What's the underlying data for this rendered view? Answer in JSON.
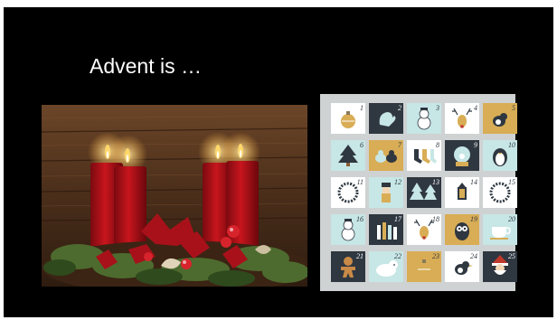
{
  "slide": {
    "title": "Advent is …"
  },
  "photo": {
    "subject": "advent-wreath-four-red-candles",
    "colors": {
      "wood": "#5a3a22",
      "candle": "#b3121a",
      "flame": "#ffcf5a",
      "greenery": "#4d6b2e"
    }
  },
  "calendar": {
    "background": "#cfd2d2",
    "tiles": [
      {
        "num": "1",
        "icon": "ornament-icon",
        "bg": "#ffffff"
      },
      {
        "num": "2",
        "icon": "mitten-icon",
        "bg": "#2f3740"
      },
      {
        "num": "3",
        "icon": "snowman-icon",
        "bg": "#c7e6e6"
      },
      {
        "num": "4",
        "icon": "reindeer-icon",
        "bg": "#ffffff"
      },
      {
        "num": "5",
        "icon": "bird-icon",
        "bg": "#d8ad55"
      },
      {
        "num": "6",
        "icon": "christmas-tree-icon",
        "bg": "#c7e6e6"
      },
      {
        "num": "7",
        "icon": "birds-icon",
        "bg": "#d8ad55"
      },
      {
        "num": "8",
        "icon": "stockings-icon",
        "bg": "#ffffff"
      },
      {
        "num": "9",
        "icon": "snow-globe-icon",
        "bg": "#2f3740"
      },
      {
        "num": "10",
        "icon": "penguin-icon",
        "bg": "#c7e6e6"
      },
      {
        "num": "11",
        "icon": "wreath-icon",
        "bg": "#ffffff"
      },
      {
        "num": "12",
        "icon": "nutcracker-icon",
        "bg": "#c7e6e6"
      },
      {
        "num": "13",
        "icon": "pine-trees-icon",
        "bg": "#2f3740"
      },
      {
        "num": "14",
        "icon": "lantern-icon",
        "bg": "#ffffff"
      },
      {
        "num": "15",
        "icon": "wreath-icon",
        "bg": "#ffffff"
      },
      {
        "num": "16",
        "icon": "snowman-icon",
        "bg": "#c7e6e6"
      },
      {
        "num": "17",
        "icon": "candles-icon",
        "bg": "#2f3740"
      },
      {
        "num": "18",
        "icon": "reindeer-icon",
        "bg": "#ffffff"
      },
      {
        "num": "19",
        "icon": "owl-icon",
        "bg": "#d8ad55"
      },
      {
        "num": "20",
        "icon": "teacup-icon",
        "bg": "#c7e6e6"
      },
      {
        "num": "21",
        "icon": "gingerbread-icon",
        "bg": "#2f3740"
      },
      {
        "num": "22",
        "icon": "polar-bear-icon",
        "bg": "#c7e6e6"
      },
      {
        "num": "23",
        "icon": "ornament-icon",
        "bg": "#d8ad55"
      },
      {
        "num": "24",
        "icon": "bird-icon",
        "bg": "#ffffff"
      },
      {
        "num": "25",
        "icon": "santa-icon",
        "bg": "#2f3740"
      }
    ]
  }
}
